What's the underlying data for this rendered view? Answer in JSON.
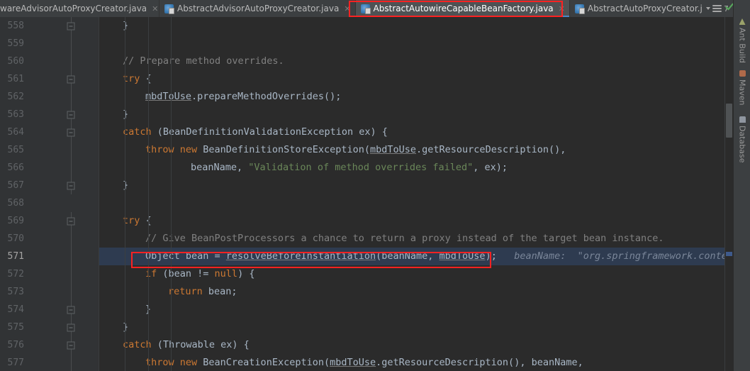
{
  "tabs": [
    {
      "label": "wareAdvisorAutoProxyCreator.java",
      "icon": "java-file-icon",
      "active": false,
      "closable": true,
      "truncated_left": true
    },
    {
      "label": "AbstractAdvisorAutoProxyCreator.java",
      "icon": "java-file-icon",
      "active": false,
      "closable": true
    },
    {
      "label": "AbstractAutowireCapableBeanFactory.java",
      "icon": "java-file-icon",
      "active": true,
      "closable": true
    },
    {
      "label": "AbstractAutoProxyCreator.java",
      "icon": "java-file-icon",
      "active": false,
      "closable": true
    }
  ],
  "tabbar_right": {
    "dropdown_icon": "chevron-down-icon",
    "list_icon": "tab-list-icon",
    "count": "7"
  },
  "annotations": {
    "tab_highlight_color": "#fc2222",
    "code_highlight_color": "#fc2222",
    "annotated_tab": "AbstractAutowireCapableBeanFactory.java",
    "annotated_code": "Object bean = resolveBeforeInstantiation(beanName, mbdToUse);"
  },
  "editor": {
    "current_line": "571",
    "lines": [
      {
        "num": "558",
        "indent": 1,
        "text": "}"
      },
      {
        "num": "559",
        "indent": 0,
        "text": ""
      },
      {
        "num": "560",
        "indent": 2,
        "text": "// Prepare method overrides."
      },
      {
        "num": "561",
        "indent": 2,
        "text": "try {"
      },
      {
        "num": "562",
        "indent": 3,
        "text": "mbdToUse.prepareMethodOverrides();"
      },
      {
        "num": "563",
        "indent": 2,
        "text": "}"
      },
      {
        "num": "564",
        "indent": 2,
        "text": "catch (BeanDefinitionValidationException ex) {"
      },
      {
        "num": "565",
        "indent": 3,
        "text": "throw new BeanDefinitionStoreException(mbdToUse.getResourceDescription(),"
      },
      {
        "num": "566",
        "indent": 5,
        "text": "beanName, \"Validation of method overrides failed\", ex);"
      },
      {
        "num": "567",
        "indent": 2,
        "text": "}"
      },
      {
        "num": "568",
        "indent": 0,
        "text": ""
      },
      {
        "num": "569",
        "indent": 2,
        "text": "try {"
      },
      {
        "num": "570",
        "indent": 3,
        "text": "// Give BeanPostProcessors a chance to return a proxy instead of the target bean instance."
      },
      {
        "num": "571",
        "indent": 3,
        "text": "Object bean = resolveBeforeInstantiation(beanName, mbdToUse);",
        "highlighted": true,
        "inline_hint": "beanName:  \"org.springframework.context.eve"
      },
      {
        "num": "572",
        "indent": 3,
        "text": "if (bean != null) {"
      },
      {
        "num": "573",
        "indent": 4,
        "text": "return bean;"
      },
      {
        "num": "574",
        "indent": 3,
        "text": "}"
      },
      {
        "num": "575",
        "indent": 2,
        "text": "}"
      },
      {
        "num": "576",
        "indent": 2,
        "text": "catch (Throwable ex) {"
      },
      {
        "num": "577",
        "indent": 3,
        "text": "throw new BeanCreationException(mbdToUse.getResourceDescription(), beanName,"
      }
    ]
  },
  "right_sidebar": {
    "items": [
      {
        "label": "Ant Build",
        "icon": "ant-build-icon"
      },
      {
        "label": "Maven",
        "icon": "maven-icon"
      },
      {
        "label": "Database",
        "icon": "database-icon"
      }
    ]
  },
  "inspection": {
    "status_icon": "green-check-icon",
    "status_color": "#58a65c"
  }
}
